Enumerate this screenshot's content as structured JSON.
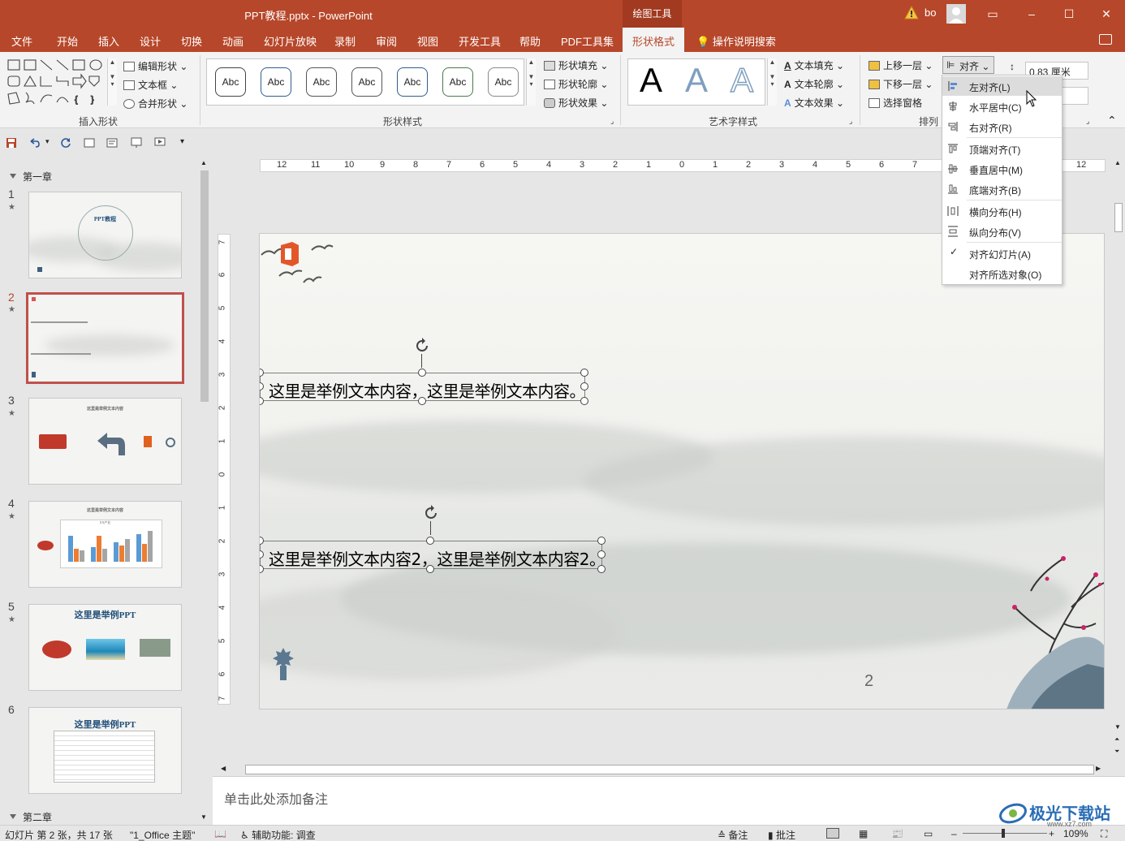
{
  "window": {
    "title": "PPT教程.pptx  -  PowerPoint",
    "context_tool": "绘图工具",
    "user": "bo",
    "controls": [
      "▭",
      "–",
      "☐",
      "✕"
    ]
  },
  "tabs": [
    "文件",
    "开始",
    "插入",
    "设计",
    "切换",
    "动画",
    "幻灯片放映",
    "录制",
    "审阅",
    "视图",
    "开发工具",
    "帮助",
    "PDF工具集",
    "形状格式"
  ],
  "active_tab": "形状格式",
  "tell_me": "操作说明搜索",
  "ribbon": {
    "insert_shapes": {
      "label": "插入形状",
      "edit_shape": "编辑形状",
      "textbox": "文本框",
      "merge_shapes": "合并形状"
    },
    "shape_styles": {
      "label": "形状样式",
      "style_sample": "Abc",
      "fill": "形状填充",
      "outline": "形状轮廓",
      "effects": "形状效果"
    },
    "wordart": {
      "label": "艺术字样式",
      "glyph": "A",
      "text_fill": "文本填充",
      "text_outline": "文本轮廓",
      "text_effects": "文本效果"
    },
    "arrange": {
      "label": "排列",
      "bring_forward": "上移一层",
      "send_backward": "下移一层",
      "selection_pane": "选择窗格",
      "align": "对齐"
    },
    "size": {
      "height": "0.83 厘米"
    }
  },
  "align_menu": [
    {
      "label": "左对齐(L)",
      "hover": true
    },
    {
      "label": "水平居中(C)"
    },
    {
      "label": "右对齐(R)"
    },
    {
      "label": "顶端对齐(T)"
    },
    {
      "label": "垂直居中(M)"
    },
    {
      "label": "底端对齐(B)"
    },
    {
      "label": "横向分布(H)"
    },
    {
      "label": "纵向分布(V)"
    },
    {
      "label": "对齐幻灯片(A)",
      "checked": true
    },
    {
      "label": "对齐所选对象(O)"
    }
  ],
  "sections": {
    "first": "第一章",
    "second": "第二章"
  },
  "thumbnails": [
    {
      "num": "1",
      "title": "PPT教程"
    },
    {
      "num": "2",
      "active": true
    },
    {
      "num": "3",
      "title": "这里是举例文本内容"
    },
    {
      "num": "4",
      "title": "这里是举例文本内容",
      "chart_caption": "XX产业"
    },
    {
      "num": "5",
      "title": "这里是举例PPT"
    },
    {
      "num": "6",
      "title": "这里是举例PPT"
    }
  ],
  "ruler": {
    "horizontal": [
      "12",
      "11",
      "10",
      "9",
      "8",
      "7",
      "6",
      "5",
      "4",
      "3",
      "2",
      "1",
      "0",
      "1",
      "2",
      "3",
      "4",
      "5",
      "6",
      "7",
      "12"
    ],
    "vertical": [
      "7",
      "6",
      "5",
      "4",
      "3",
      "2",
      "1",
      "0",
      "1",
      "2",
      "3",
      "4",
      "5",
      "6",
      "7"
    ]
  },
  "slide": {
    "textbox1": "这里是举例文本内容，这里是举例文本内容。",
    "textbox2": "这里是举例文本内容2，这里是举例文本内容2。",
    "page_number": "2"
  },
  "notes": {
    "placeholder": "单击此处添加备注"
  },
  "status": {
    "slide_info": "幻灯片 第 2 张，共 17 张",
    "theme": "\"1_Office 主题\"",
    "accessibility": "辅助功能: 调查",
    "notes": "备注",
    "comments": "批注",
    "zoom": "109%"
  },
  "watermark": {
    "name": "极光下载站",
    "url": "www.xz7.com"
  },
  "colors": {
    "accent": "#b7472a",
    "selected_thumb_border": "#c0504d",
    "title_blue": "#1f4e79"
  }
}
